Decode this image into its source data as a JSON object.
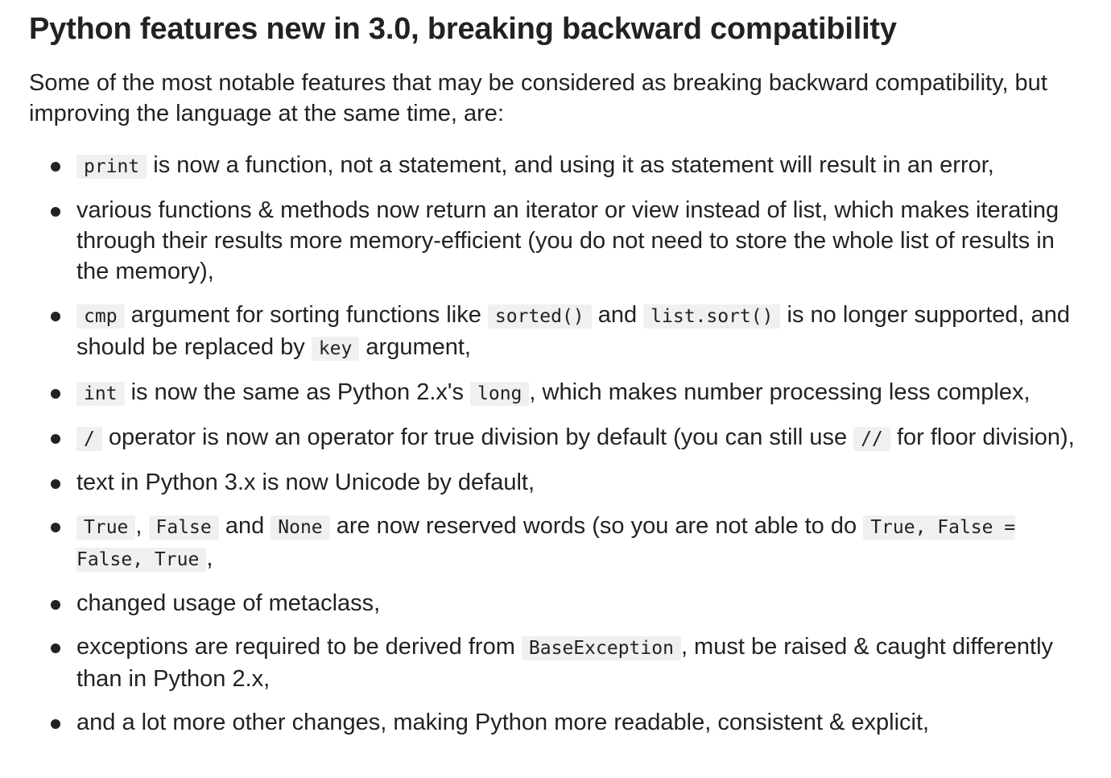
{
  "title": "Python features new in 3.0, breaking backward compatibility",
  "intro": "Some of the most notable features that may be considered as breaking backward compatibility, but improving the language at the same time, are:",
  "items": [
    {
      "parts": [
        {
          "code": "print"
        },
        {
          "text": " is now a function, not a statement, and using it as statement will result in an error,"
        }
      ]
    },
    {
      "parts": [
        {
          "text": "various functions & methods now return an iterator or view instead of list, which makes iterating through their results more memory-efficient (you do not need to store the whole list of results in the memory),"
        }
      ]
    },
    {
      "parts": [
        {
          "code": "cmp"
        },
        {
          "text": " argument for sorting functions like "
        },
        {
          "code": "sorted()"
        },
        {
          "text": " and "
        },
        {
          "code": "list.sort()"
        },
        {
          "text": " is no longer supported, and should be replaced by "
        },
        {
          "code": "key"
        },
        {
          "text": " argument,"
        }
      ]
    },
    {
      "parts": [
        {
          "code": "int"
        },
        {
          "text": " is now the same as Python 2.x's "
        },
        {
          "code": "long"
        },
        {
          "text": ", which makes number processing less complex,"
        }
      ]
    },
    {
      "parts": [
        {
          "code": "/"
        },
        {
          "text": " operator is now an operator for true division by default (you can still use "
        },
        {
          "code": "//"
        },
        {
          "text": " for floor division),"
        }
      ]
    },
    {
      "parts": [
        {
          "text": "text in Python 3.x is now Unicode by default,"
        }
      ]
    },
    {
      "parts": [
        {
          "code": "True"
        },
        {
          "text": ", "
        },
        {
          "code": "False"
        },
        {
          "text": " and "
        },
        {
          "code": "None"
        },
        {
          "text": " are now reserved words (so you are not able to do "
        },
        {
          "code": "True, False = False, True"
        },
        {
          "text": ","
        }
      ]
    },
    {
      "parts": [
        {
          "text": "changed usage of metaclass,"
        }
      ]
    },
    {
      "parts": [
        {
          "text": "exceptions are required to be derived from "
        },
        {
          "code": "BaseException"
        },
        {
          "text": ", must be raised & caught differently than in Python 2.x,"
        }
      ]
    },
    {
      "parts": [
        {
          "text": "and a lot more other changes, making Python more readable, consistent & explicit,"
        }
      ]
    }
  ]
}
